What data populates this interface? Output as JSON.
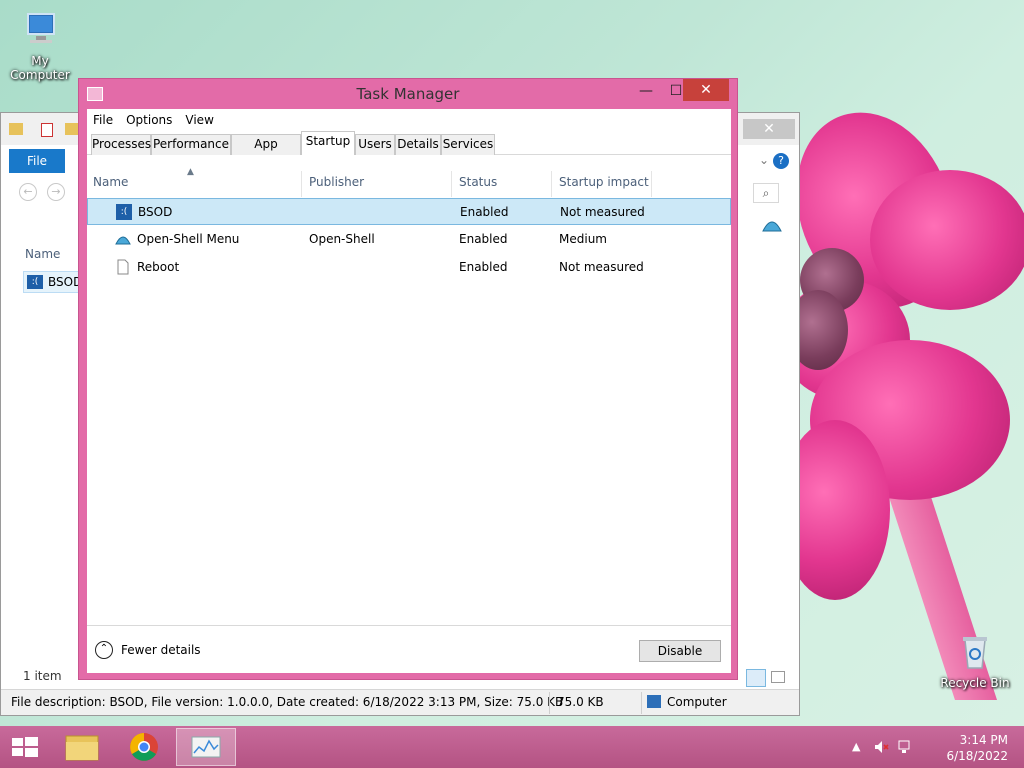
{
  "desktop": {
    "icons": [
      {
        "label": "My Computer"
      },
      {
        "label": "Recycle Bin"
      }
    ]
  },
  "explorer": {
    "file_tab": "File",
    "column_name": "Name",
    "item_name": "BSOD",
    "items_count": "1 item",
    "status_description": "File description: BSOD, File version: 1.0.0.0, Date created: 6/18/2022 3:13 PM, Size: 75.0 KB",
    "status_size": "75.0 KB",
    "status_location": "Computer",
    "close_glyph": "✕"
  },
  "taskmanager": {
    "title": "Task Manager",
    "menu": [
      "File",
      "Options",
      "View"
    ],
    "tabs": [
      "Processes",
      "Performance",
      "App history",
      "Startup",
      "Users",
      "Details",
      "Services"
    ],
    "active_tab": "Startup",
    "columns": [
      "Name",
      "Publisher",
      "Status",
      "Startup impact"
    ],
    "rows": [
      {
        "name": "BSOD",
        "publisher": "",
        "status": "Enabled",
        "impact": "Not measured",
        "icon": "bsod-icon",
        "selected": true
      },
      {
        "name": "Open-Shell Menu",
        "publisher": "Open-Shell",
        "status": "Enabled",
        "impact": "Medium",
        "icon": "open-shell-icon",
        "selected": false
      },
      {
        "name": "Reboot",
        "publisher": "",
        "status": "Enabled",
        "impact": "Not measured",
        "icon": "file-icon",
        "selected": false
      }
    ],
    "fewer_details": "Fewer details",
    "disable_button": "Disable",
    "window_buttons": {
      "minimize": "—",
      "maximize": "☐",
      "close": "✕"
    }
  },
  "taskbar": {
    "time": "3:14 PM",
    "date": "6/18/2022"
  },
  "colors": {
    "accent_pink": "#e36ba8",
    "close_red": "#c7413b",
    "selection_blue": "#cce8f7",
    "ribbon_blue": "#1979ca"
  }
}
